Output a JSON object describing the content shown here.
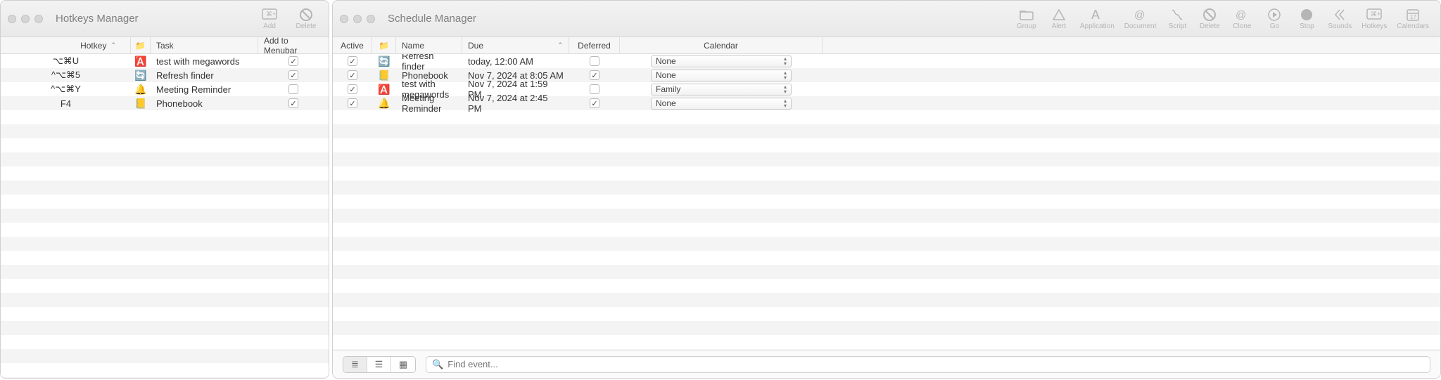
{
  "hotkeys_window": {
    "title": "Hotkeys Manager",
    "toolbar": {
      "add": "Add",
      "delete": "Delete"
    },
    "columns": {
      "hotkey": "Hotkey",
      "task": "Task",
      "menubar": "Add to Menubar"
    },
    "rows": [
      {
        "hotkey": "⌥⌘U",
        "icon": "🅰️",
        "task": "test with megawords",
        "menubar": true
      },
      {
        "hotkey": "^⌥⌘5",
        "icon": "🔄",
        "task": "Refresh finder",
        "menubar": true
      },
      {
        "hotkey": "^⌥⌘Y",
        "icon": "🔔",
        "task": "Meeting Reminder",
        "menubar": false
      },
      {
        "hotkey": "F4",
        "icon": "📒",
        "task": "Phonebook",
        "menubar": true
      }
    ]
  },
  "schedule_window": {
    "title": "Schedule Manager",
    "toolbar": [
      {
        "name": "group",
        "label": "Group",
        "glyph": "folder"
      },
      {
        "name": "alert",
        "label": "Alert",
        "glyph": "alert"
      },
      {
        "name": "application",
        "label": "Application",
        "glyph": "app"
      },
      {
        "name": "document",
        "label": "Document",
        "glyph": "doc"
      },
      {
        "name": "script",
        "label": "Script",
        "glyph": "script"
      },
      {
        "name": "delete",
        "label": "Delete",
        "glyph": "nope"
      },
      {
        "name": "clone",
        "label": "Clone",
        "glyph": "clone"
      },
      {
        "name": "go",
        "label": "Go",
        "glyph": "play"
      },
      {
        "name": "stop",
        "label": "Stop",
        "glyph": "stop"
      },
      {
        "name": "sounds",
        "label": "Sounds",
        "glyph": "sound"
      },
      {
        "name": "hotkeys",
        "label": "Hotkeys",
        "glyph": "key"
      },
      {
        "name": "calendars",
        "label": "Calendars",
        "glyph": "cal"
      }
    ],
    "columns": {
      "active": "Active",
      "name": "Name",
      "due": "Due",
      "deferred": "Deferred",
      "calendar": "Calendar"
    },
    "rows": [
      {
        "active": true,
        "icon": "🔄",
        "name": "Refresh finder",
        "due": "today, 12:00 AM",
        "deferred": false,
        "calendar": "None"
      },
      {
        "active": true,
        "icon": "📒",
        "name": "Phonebook",
        "due": "Nov 7, 2024 at 8:05 AM",
        "deferred": true,
        "calendar": "None"
      },
      {
        "active": true,
        "icon": "🅰️",
        "name": "test with megawords",
        "due": "Nov 7, 2024 at 1:59 PM",
        "deferred": false,
        "calendar": "Family"
      },
      {
        "active": true,
        "icon": "🔔",
        "name": "Meeting Reminder",
        "due": "Nov 7, 2024 at 2:45 PM",
        "deferred": true,
        "calendar": "None"
      }
    ],
    "search_placeholder": "Find event..."
  }
}
